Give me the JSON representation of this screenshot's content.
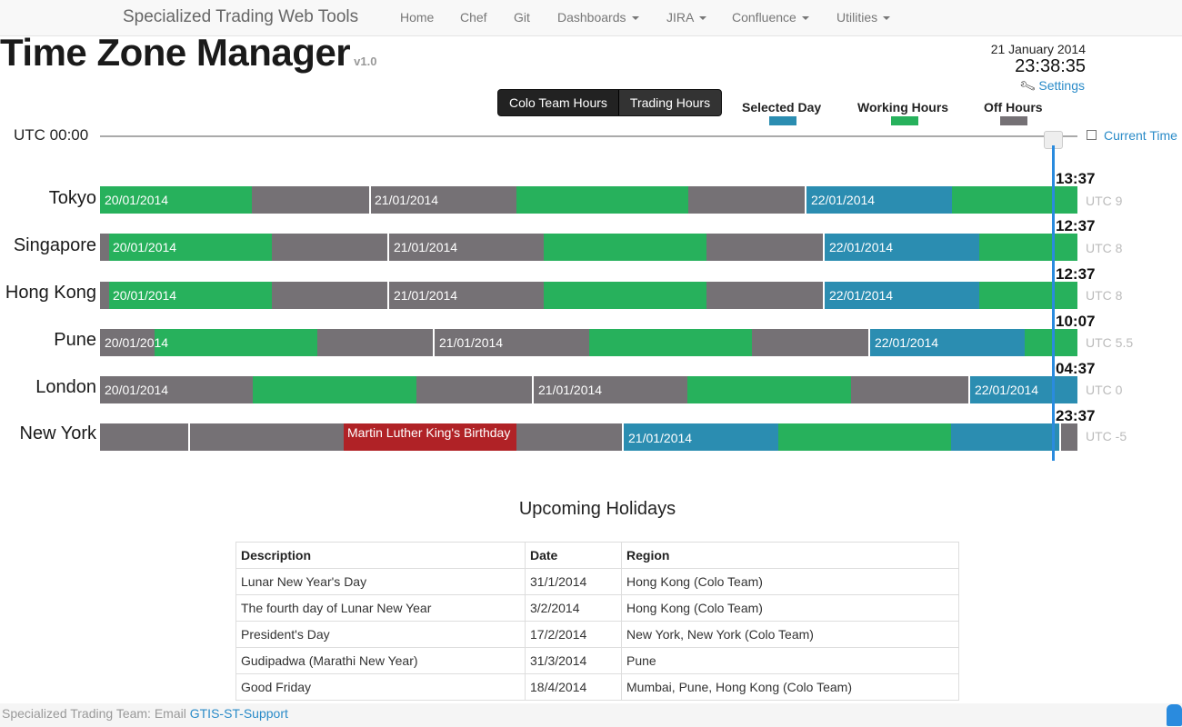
{
  "navbar": {
    "brand": "Specialized Trading Web Tools",
    "items": [
      "Home",
      "Chef",
      "Git",
      "Dashboards",
      "JIRA",
      "Confluence",
      "Utilities"
    ]
  },
  "header": {
    "title": "Time Zone Manager",
    "version": "v1.0",
    "date": "21 January 2014",
    "time": "23:38:35",
    "settings_label": "Settings"
  },
  "toggles": [
    "Colo Team Hours",
    "Trading Hours"
  ],
  "legend": {
    "selected_day": {
      "label": "Selected Day",
      "color": "#2b8db1"
    },
    "working_hours": {
      "label": "Working Hours",
      "color": "#27b15c"
    },
    "off_hours": {
      "label": "Off Hours",
      "color": "#757175"
    }
  },
  "slider": {
    "label": "UTC 00:00",
    "current_time_label": "Current Time",
    "current_time_checked": false
  },
  "timezones": [
    {
      "city": "Tokyo",
      "local_time": "13:37",
      "offset": "UTC 9",
      "dates": [
        "20/01/2014",
        "21/01/2014",
        "22/01/2014"
      ]
    },
    {
      "city": "Singapore",
      "local_time": "12:37",
      "offset": "UTC 8",
      "dates": [
        "20/01/2014",
        "21/01/2014",
        "22/01/2014"
      ]
    },
    {
      "city": "Hong Kong",
      "local_time": "12:37",
      "offset": "UTC 8",
      "dates": [
        "20/01/2014",
        "21/01/2014",
        "22/01/2014"
      ]
    },
    {
      "city": "Pune",
      "local_time": "10:07",
      "offset": "UTC 5.5",
      "dates": [
        "20/01/2014",
        "21/01/2014",
        "22/01/2014"
      ]
    },
    {
      "city": "London",
      "local_time": "04:37",
      "offset": "UTC 0",
      "dates": [
        "20/01/2014",
        "21/01/2014",
        "22/01/2014"
      ]
    },
    {
      "city": "New York",
      "local_time": "23:37",
      "offset": "UTC -5",
      "holiday": "Martin Luther King's Birthday",
      "dates": [
        "21/01/2014"
      ]
    }
  ],
  "holidays": {
    "title": "Upcoming Holidays",
    "columns": [
      "Description",
      "Date",
      "Region"
    ],
    "rows": [
      [
        "Lunar New Year's Day",
        "31/1/2014",
        "Hong Kong (Colo Team)"
      ],
      [
        "The fourth day of Lunar New Year",
        "3/2/2014",
        "Hong Kong (Colo Team)"
      ],
      [
        "President's Day",
        "17/2/2014",
        "New York, New York (Colo Team)"
      ],
      [
        "Gudipadwa (Marathi New Year)",
        "31/3/2014",
        "Pune"
      ],
      [
        "Good Friday",
        "18/4/2014",
        "Mumbai, Pune, Hong Kong (Colo Team)"
      ]
    ]
  },
  "footer": {
    "text": "Specialized Trading Team: Email",
    "link": "GTIS-ST-Support"
  }
}
